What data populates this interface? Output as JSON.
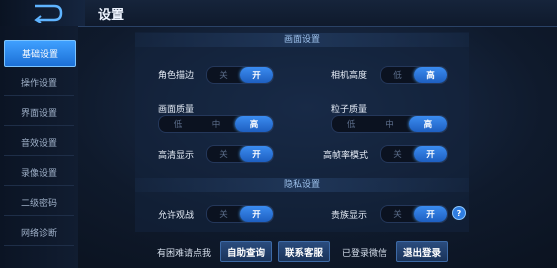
{
  "header": {
    "title": "设置"
  },
  "sidebar": {
    "items": [
      {
        "label": "基础设置",
        "active": true
      },
      {
        "label": "操作设置"
      },
      {
        "label": "界面设置"
      },
      {
        "label": "音效设置"
      },
      {
        "label": "录像设置"
      },
      {
        "label": "二级密码"
      },
      {
        "label": "网络诊断"
      }
    ]
  },
  "graphics": {
    "section_title": "画面设置",
    "outline": {
      "label": "角色描边",
      "options": [
        "关",
        "开"
      ],
      "selected": "开"
    },
    "camera_height": {
      "label": "相机高度",
      "options": [
        "低",
        "高"
      ],
      "selected": "高"
    },
    "quality": {
      "label": "画面质量",
      "options": [
        "低",
        "中",
        "高"
      ],
      "selected": "高"
    },
    "particle_quality": {
      "label": "粒子质量",
      "options": [
        "低",
        "中",
        "高"
      ],
      "selected": "高"
    },
    "hd_display": {
      "label": "高清显示",
      "options": [
        "关",
        "开"
      ],
      "selected": "开"
    },
    "high_fps": {
      "label": "高帧率模式",
      "options": [
        "关",
        "开"
      ],
      "selected": "开"
    }
  },
  "privacy": {
    "section_title": "隐私设置",
    "allow_watch": {
      "label": "允许观战",
      "options": [
        "关",
        "开"
      ],
      "selected": "开"
    },
    "noble_display": {
      "label": "贵族显示",
      "options": [
        "关",
        "开"
      ],
      "selected": "开"
    },
    "help_icon": "?"
  },
  "footer": {
    "trouble_text": "有困难请点我",
    "self_service_button": "自助查询",
    "contact_button": "联系客服",
    "login_status": "已登录微信",
    "logout_button": "退出登录"
  },
  "colors": {
    "accent": "#2f7de0",
    "background": "#0f1a2c"
  }
}
